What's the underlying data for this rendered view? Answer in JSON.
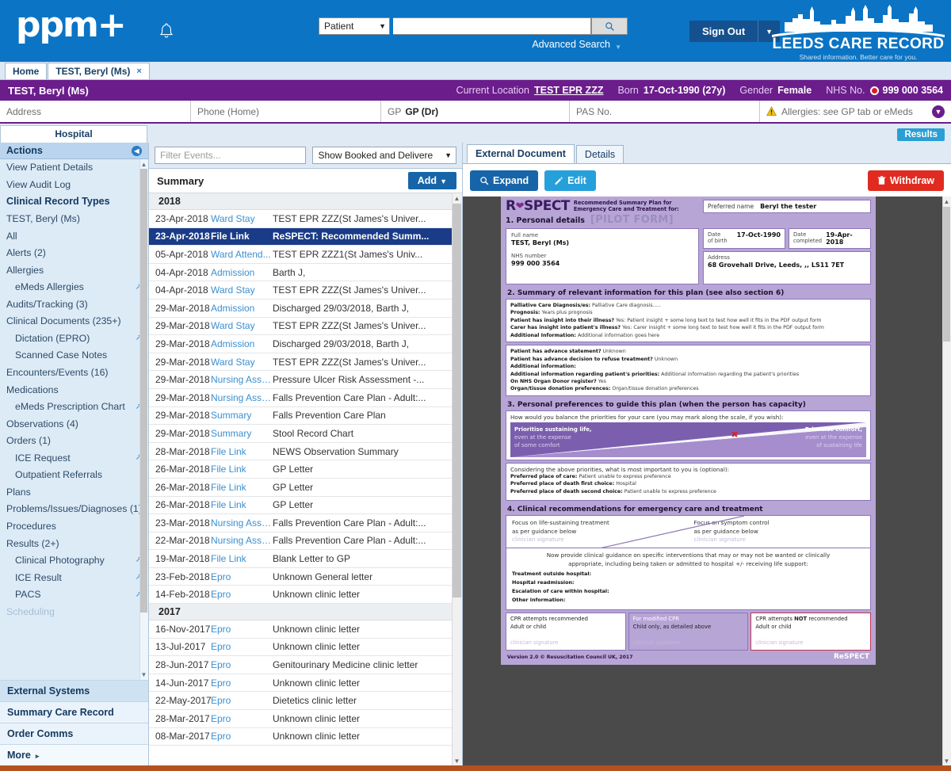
{
  "header": {
    "logo_text": "ppm+",
    "search_type": "Patient",
    "search_value": "",
    "search_placeholder": "",
    "advanced_search": "Advanced Search",
    "sign_out": "Sign Out",
    "brand_title": "LEEDS CARE RECORD",
    "brand_tagline": "Shared information. Better care for you.",
    "accent_blue": "#0b74c4",
    "accent_purple": "#6b1d8c"
  },
  "tabs": [
    {
      "label": "Home",
      "closable": false
    },
    {
      "label": "TEST, Beryl (Ms)",
      "closable": true,
      "close_glyph": "×"
    }
  ],
  "patient_banner": {
    "name": "TEST, Beryl (Ms)",
    "location_label": "Current Location",
    "location_value": "TEST EPR ZZZ",
    "born_label": "Born",
    "born_value": "17-Oct-1990 (27y)",
    "gender_label": "Gender",
    "gender_value": "Female",
    "nhs_label": "NHS No.",
    "nhs_value": "999 000 3564"
  },
  "demographics": [
    {
      "label": "Address",
      "value": ""
    },
    {
      "label": "Phone (Home)",
      "value": ""
    },
    {
      "label": "GP",
      "value": "GP (Dr)"
    },
    {
      "label": "PAS No.",
      "value": ""
    },
    {
      "label": "Allergies: see GP tab or eMeds",
      "value": ""
    }
  ],
  "subnav": {
    "hospital_tab": "Hospital",
    "results_button": "Results"
  },
  "sidebar": {
    "header": "Actions",
    "items": [
      {
        "label": "View Patient Details",
        "style": "normal"
      },
      {
        "label": "View Audit Log",
        "style": "normal"
      },
      {
        "label": "Clinical Record Types",
        "style": "bold"
      },
      {
        "label": "TEST, Beryl (Ms)",
        "style": "normal"
      },
      {
        "label": "All",
        "style": "normal"
      },
      {
        "label": "Alerts (2)",
        "style": "normal"
      },
      {
        "label": "Allergies",
        "style": "normal"
      },
      {
        "label": "eMeds Allergies",
        "style": "indent",
        "ext": true
      },
      {
        "label": "Audits/Tracking (3)",
        "style": "normal"
      },
      {
        "label": "Clinical Documents (235+)",
        "style": "normal"
      },
      {
        "label": "Dictation (EPRO)",
        "style": "indent",
        "ext": true
      },
      {
        "label": "Scanned Case Notes",
        "style": "indent",
        "arrow": true
      },
      {
        "label": "Encounters/Events (16)",
        "style": "normal"
      },
      {
        "label": "Medications",
        "style": "normal"
      },
      {
        "label": "eMeds Prescription Chart",
        "style": "indent",
        "ext": true
      },
      {
        "label": "Observations (4)",
        "style": "normal"
      },
      {
        "label": "Orders (1)",
        "style": "normal"
      },
      {
        "label": "ICE Request",
        "style": "indent",
        "ext": true
      },
      {
        "label": "Outpatient Referrals",
        "style": "indent",
        "arrow": true
      },
      {
        "label": "Plans",
        "style": "normal"
      },
      {
        "label": "Problems/Issues/Diagnoses (1)",
        "style": "normal"
      },
      {
        "label": "Procedures",
        "style": "normal"
      },
      {
        "label": "Results (2+)",
        "style": "normal"
      },
      {
        "label": "Clinical Photography",
        "style": "indent",
        "ext": true
      },
      {
        "label": "ICE Result",
        "style": "indent",
        "ext": true
      },
      {
        "label": "PACS",
        "style": "indent",
        "ext": true
      },
      {
        "label": "Scheduling",
        "style": "dim"
      }
    ],
    "footer_items": [
      {
        "label": "External Systems",
        "tone": "dark"
      },
      {
        "label": "Summary Care Record",
        "tone": "light"
      },
      {
        "label": "Order Comms",
        "tone": "light"
      },
      {
        "label": "More",
        "tone": "white",
        "arrow": "▸"
      }
    ]
  },
  "events": {
    "filter_placeholder": "Filter Events...",
    "filter_value": "",
    "show_select": "Show Booked and Delivere",
    "summary_title": "Summary",
    "add_button": "Add",
    "groups": [
      {
        "year": "2018",
        "rows": [
          {
            "date": "23-Apr-2018",
            "type": "Ward Stay",
            "desc": "TEST EPR ZZZ(St James's Univer...",
            "selected": false
          },
          {
            "date": "23-Apr-2018",
            "type": "File Link",
            "desc": "ReSPECT: Recommended Summ...",
            "selected": true
          },
          {
            "date": "05-Apr-2018",
            "type": "Ward Attend...",
            "desc": "TEST EPR ZZZ1(St James's Univ...",
            "selected": false
          },
          {
            "date": "04-Apr-2018",
            "type": "Admission",
            "desc": "Barth J,",
            "selected": false
          },
          {
            "date": "04-Apr-2018",
            "type": "Ward Stay",
            "desc": "TEST EPR ZZZ(St James's Univer...",
            "selected": false
          },
          {
            "date": "29-Mar-2018",
            "type": "Admission",
            "desc": "Discharged 29/03/2018, Barth J,",
            "selected": false
          },
          {
            "date": "29-Mar-2018",
            "type": "Ward Stay",
            "desc": "TEST EPR ZZZ(St James's Univer...",
            "selected": false
          },
          {
            "date": "29-Mar-2018",
            "type": "Admission",
            "desc": "Discharged 29/03/2018, Barth J,",
            "selected": false
          },
          {
            "date": "29-Mar-2018",
            "type": "Ward Stay",
            "desc": "TEST EPR ZZZ(St James's Univer...",
            "selected": false
          },
          {
            "date": "29-Mar-2018",
            "type": "Nursing Assess",
            "desc": "Pressure Ulcer Risk Assessment -...",
            "selected": false
          },
          {
            "date": "29-Mar-2018",
            "type": "Nursing Assess",
            "desc": "Falls Prevention Care Plan - Adult:...",
            "selected": false
          },
          {
            "date": "29-Mar-2018",
            "type": "Summary",
            "desc": "Falls Prevention Care Plan",
            "selected": false
          },
          {
            "date": "29-Mar-2018",
            "type": "Summary",
            "desc": "Stool Record Chart",
            "selected": false
          },
          {
            "date": "28-Mar-2018",
            "type": "File Link",
            "desc": "NEWS Observation Summary",
            "selected": false
          },
          {
            "date": "26-Mar-2018",
            "type": "File Link",
            "desc": "GP Letter",
            "selected": false
          },
          {
            "date": "26-Mar-2018",
            "type": "File Link",
            "desc": "GP Letter",
            "selected": false
          },
          {
            "date": "26-Mar-2018",
            "type": "File Link",
            "desc": "GP Letter",
            "selected": false
          },
          {
            "date": "23-Mar-2018",
            "type": "Nursing Assess",
            "desc": "Falls Prevention Care Plan - Adult:...",
            "selected": false
          },
          {
            "date": "22-Mar-2018",
            "type": "Nursing Assess",
            "desc": "Falls Prevention Care Plan - Adult:...",
            "selected": false
          },
          {
            "date": "19-Mar-2018",
            "type": "File Link",
            "desc": "Blank Letter to GP",
            "selected": false
          },
          {
            "date": "23-Feb-2018",
            "type": "Epro",
            "desc": "Unknown General letter",
            "selected": false
          },
          {
            "date": "14-Feb-2018",
            "type": "Epro",
            "desc": "Unknown clinic letter",
            "selected": false
          }
        ]
      },
      {
        "year": "2017",
        "rows": [
          {
            "date": "16-Nov-2017",
            "type": "Epro",
            "desc": "Unknown clinic letter",
            "selected": false
          },
          {
            "date": "13-Jul-2017",
            "type": "Epro",
            "desc": "Unknown clinic letter",
            "selected": false
          },
          {
            "date": "28-Jun-2017",
            "type": "Epro",
            "desc": "Genitourinary Medicine clinic letter",
            "selected": false
          },
          {
            "date": "14-Jun-2017",
            "type": "Epro",
            "desc": "Unknown clinic letter",
            "selected": false
          },
          {
            "date": "22-May-2017",
            "type": "Epro",
            "desc": "Dietetics clinic letter",
            "selected": false
          },
          {
            "date": "28-Mar-2017",
            "type": "Epro",
            "desc": "Unknown clinic letter",
            "selected": false
          },
          {
            "date": "08-Mar-2017",
            "type": "Epro",
            "desc": "Unknown clinic letter",
            "selected": false
          }
        ]
      }
    ]
  },
  "doc_panel": {
    "tabs": [
      {
        "label": "External Document",
        "active": true
      },
      {
        "label": "Details",
        "active": false
      }
    ],
    "expand_button": "Expand",
    "edit_button": "Edit",
    "withdraw_button": "Withdraw",
    "withdraw_color": "#e02b20"
  },
  "respect_form": {
    "logo": "ReSPECT",
    "logo_pre": "R",
    "logo_post": "SPECT",
    "subtitle_line1": "Recommended Summary Plan for",
    "subtitle_line2": "Emergency Care and Treatment for:",
    "section1_title": "1. Personal details",
    "pilot_tag": "[PILOT FORM]",
    "preferred_name_label": "Preferred name",
    "preferred_name_value": "Beryl the tester",
    "full_name_label": "Full name",
    "full_name_value": "TEST, Beryl (Ms)",
    "nhs_number_label": "NHS number",
    "nhs_number_value": "999 000 3564",
    "dob_label_l1": "Date",
    "dob_label_l2": "of birth",
    "dob_value": "17-Oct-1990",
    "completed_label_l1": "Date",
    "completed_label_l2": "completed",
    "completed_value": "19-Apr-2018",
    "address_label": "Address",
    "address_value": "68 Grovehall Drive, Leeds, ,, LS11 7ET",
    "section2_title": "2. Summary of relevant information for this plan (see also section 6)",
    "s2_panel1": [
      {
        "k": "Palliative Care Diagnosis/es:",
        "v": " Palliative Care diagnosis....."
      },
      {
        "k": "Prognosis:",
        "v": " Years plus prognosis"
      },
      {
        "k": "Patient has insight into their illness?",
        "v": " Yes: Patient insight + some long text to test how well it fits in the PDF output form"
      },
      {
        "k": "Carer has insight into patient's illness?",
        "v": " Yes: Carer insight + some long text to test how well it fits in the PDF output form"
      },
      {
        "k": "Additional Information:",
        "v": " Additional information goes here"
      }
    ],
    "s2_panel2": [
      {
        "k": "Patient has advance statement?",
        "v": " Unknown"
      },
      {
        "k": "Patient has advance decision to refuse treatment?",
        "v": " Unknown"
      },
      {
        "k": "Additional information:",
        "v": ""
      },
      {
        "k": "Additional information regarding patient's priorities:",
        "v": " Additional information regarding the patient's priorities"
      },
      {
        "k": "On NHS Organ Donor register?",
        "v": " Yes"
      },
      {
        "k": "Organ/tissue donation preferences:",
        "v": " Organ/tissue donation preferences"
      }
    ],
    "section3_title": "3. Personal preferences to guide this plan (when the person has capacity)",
    "s3_question": "How would you balance the priorities for your care (you may mark along the scale, if you wish):",
    "scale_left_bold": "Prioritise sustaining life,",
    "scale_left_rest": "even at the expense\nof some comfort",
    "scale_right_bold": "Prioritise comfort,",
    "scale_right_rest": "even at the expense\nof sustaining life",
    "scale_marker": "✖",
    "s3_considering": "Considering the above priorities, what is most important to you is (optional):",
    "s3_rows": [
      {
        "k": "Preferred place of care:",
        "v": " Patient unable to express preference"
      },
      {
        "k": "Preferred place of death first choice:",
        "v": " Hospital"
      },
      {
        "k": "Preferred place of death second choice:",
        "v": " Patient unable to express preference"
      }
    ],
    "section4_title": "4. Clinical recommendations for emergency care and treatment",
    "focus_left_l1": "Focus on life-sustaining treatment",
    "focus_left_l2": "as per guidance below",
    "focus_left_sig": "clinician signature",
    "focus_right_l1": "Focus on symptom control",
    "focus_right_l2": "as per guidance below",
    "focus_right_sig": "clinician signature",
    "guide_l1": "Now provide clinical guidance on specific interventions that may or may not be wanted or clinically",
    "guide_l2": "appropriate, including being taken or admitted to hospital +/- receiving life support:",
    "guide_rows": [
      "Treatment outside hospital:",
      "Hospital readmission:",
      "Escalation of care within hospital:",
      "Other information:"
    ],
    "cpr_left_l1": "CPR attempts recommended",
    "cpr_left_l2": "Adult or child",
    "cpr_left_sig": "clinician signature",
    "cpr_mid_l1": "For modified CPR",
    "cpr_mid_l2": "Child only, as detailed above",
    "cpr_mid_sig": "clinician signature",
    "cpr_right_pre": "CPR attempts ",
    "cpr_right_bold": "NOT",
    "cpr_right_post": " recommended",
    "cpr_right_l2": "Adult or child",
    "cpr_right_sig": "clinician signature",
    "footer_left": "Version 2.0   © Resuscitation Council UK, 2017",
    "footer_right": "ReSPECT"
  }
}
